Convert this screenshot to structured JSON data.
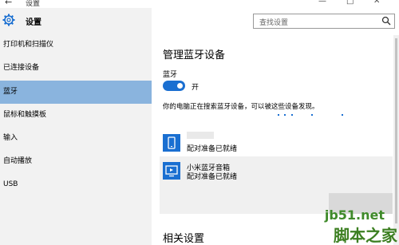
{
  "window": {
    "title": "设置",
    "back_glyph": "←",
    "min_glyph": "—",
    "max_glyph": "□",
    "close_glyph": "✕"
  },
  "header": {
    "title": "设置"
  },
  "search": {
    "placeholder": "查找设置"
  },
  "sidebar": {
    "items": [
      {
        "label": "打印机和扫描仪",
        "selected": false
      },
      {
        "label": "已连接设备",
        "selected": false
      },
      {
        "label": "蓝牙",
        "selected": true
      },
      {
        "label": "鼠标和触摸板",
        "selected": false
      },
      {
        "label": "输入",
        "selected": false
      },
      {
        "label": "自动播放",
        "selected": false
      },
      {
        "label": "USB",
        "selected": false
      }
    ]
  },
  "main": {
    "title": "管理蓝牙设备",
    "bluetooth_label": "蓝牙",
    "toggle_state": "开",
    "description": "你的电脑正在搜索蓝牙设备，可以被这些设备发现。",
    "devices": [
      {
        "name": "",
        "status": "配对准备已就绪",
        "icon": "phone-icon"
      },
      {
        "name": "小米蓝牙音箱",
        "status": "配对准备已就绪",
        "icon": "display-icon"
      }
    ],
    "related_title": "相关设置"
  },
  "watermark": {
    "top": "jb51.net",
    "bottom": "脚本之家"
  },
  "colors": {
    "accent": "#1a6fd1",
    "selected_nav": "#8ab4de",
    "sidebar_bg": "#f2f2f2"
  }
}
